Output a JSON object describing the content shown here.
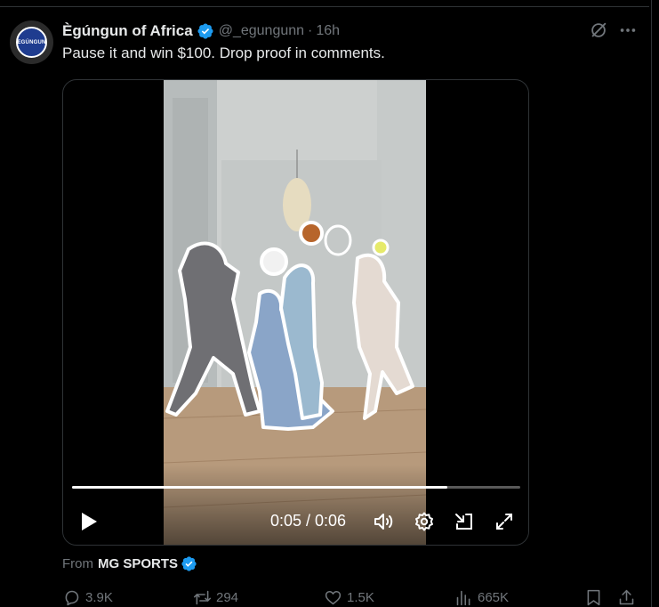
{
  "tweet": {
    "display_name": "Ègúngun of Africa",
    "handle": "@_egungunn",
    "separator": "·",
    "time": "16h",
    "text": "Pause it and win $100. Drop proof in comments.",
    "avatar_text": "EGÚNGUN"
  },
  "video": {
    "time_readout": "0:05 / 0:06",
    "progress_fraction": 0.838
  },
  "source": {
    "from_label": "From",
    "name": "MG SPORTS"
  },
  "actions": {
    "replies": "3.9K",
    "reposts": "294",
    "likes": "1.5K",
    "views": "665K"
  },
  "icons": [
    "verified-badge-icon",
    "grok-icon",
    "more-icon",
    "play-icon",
    "volume-icon",
    "settings-icon",
    "pip-icon",
    "fullscreen-icon",
    "reply-icon",
    "repost-icon",
    "like-icon",
    "views-icon",
    "bookmark-icon",
    "share-icon"
  ],
  "colors": {
    "accent": "#1d9bf0",
    "muted": "#71767b",
    "text": "#e7e9ea",
    "border": "#2f3336"
  }
}
